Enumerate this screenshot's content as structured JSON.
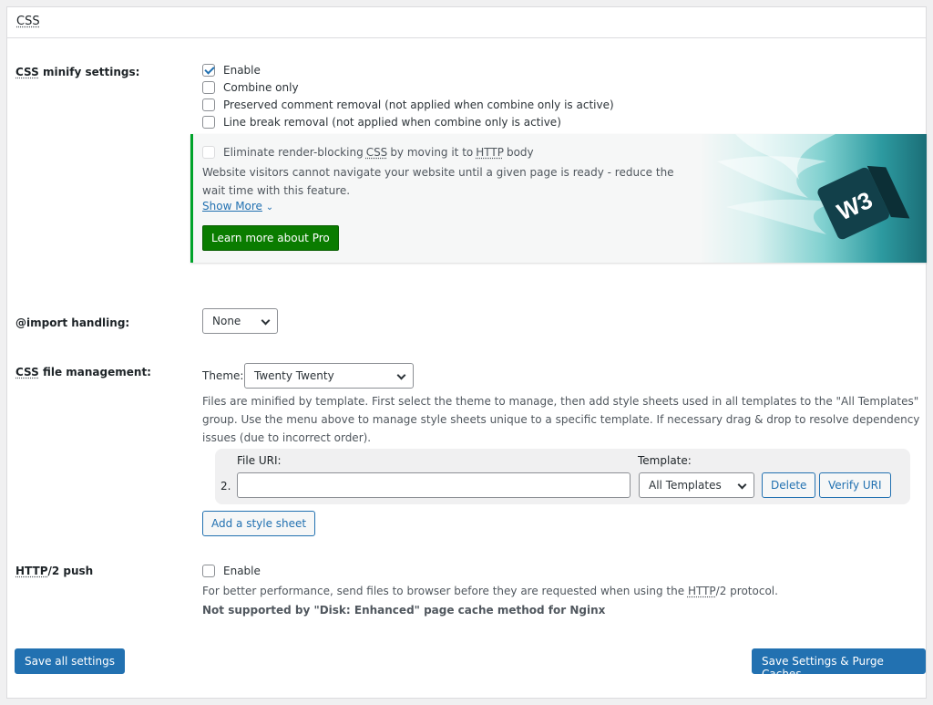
{
  "section_title": "CSS",
  "minify": {
    "label_abbr": "CSS",
    "label_rest": " minify settings:",
    "options": [
      {
        "label": "Enable",
        "checked": true
      },
      {
        "label": "Combine only",
        "checked": false
      },
      {
        "label": "Preserved comment removal (not applied when combine only is active)",
        "checked": false
      },
      {
        "label": "Line break removal (not applied when combine only is active)",
        "checked": false
      }
    ]
  },
  "promo": {
    "option_pre": "Eliminate render-blocking ",
    "option_abbr1": "CSS",
    "option_mid": " by moving it to ",
    "option_abbr2": "HTTP",
    "option_post": " body",
    "description": "Website visitors cannot navigate your website until a given page is ready - reduce the wait time with this feature.",
    "show_more": "Show More",
    "button": "Learn more about Pro",
    "logo_text": "W3"
  },
  "import": {
    "label": "@import handling:",
    "value": "None"
  },
  "file_mgmt": {
    "label_abbr": "CSS",
    "label_rest": " file management:",
    "theme_label": "Theme:",
    "theme_value": "Twenty Twenty",
    "description": "Files are minified by template. First select the theme to manage, then add style sheets used in all templates to the \"All Templates\" group. Use the menu above to manage style sheets unique to a specific template. If necessary drag & drop to resolve dependency issues (due to incorrect order).",
    "file_uri_header": "File URI:",
    "template_header": "Template:",
    "row_index": "2.",
    "file_uri_value": "",
    "template_value": "All Templates",
    "delete_label": "Delete",
    "verify_label": "Verify URI",
    "add_label": "Add a style sheet"
  },
  "http2": {
    "label_abbr": "HTTP",
    "label_rest": "/2 push",
    "enable_label": "Enable",
    "desc_pre": "For better performance, send files to browser before they are requested when using the ",
    "desc_abbr": "HTTP",
    "desc_post": "/2 protocol.",
    "note": "Not supported by \"Disk: Enhanced\" page cache method for Nginx"
  },
  "footer": {
    "save_all": "Save all settings",
    "save_purge": "Save Settings & Purge Caches"
  },
  "colors": {
    "primary": "#2271b1",
    "pro_green": "#0a7c00",
    "accent_border": "#00a32a"
  }
}
